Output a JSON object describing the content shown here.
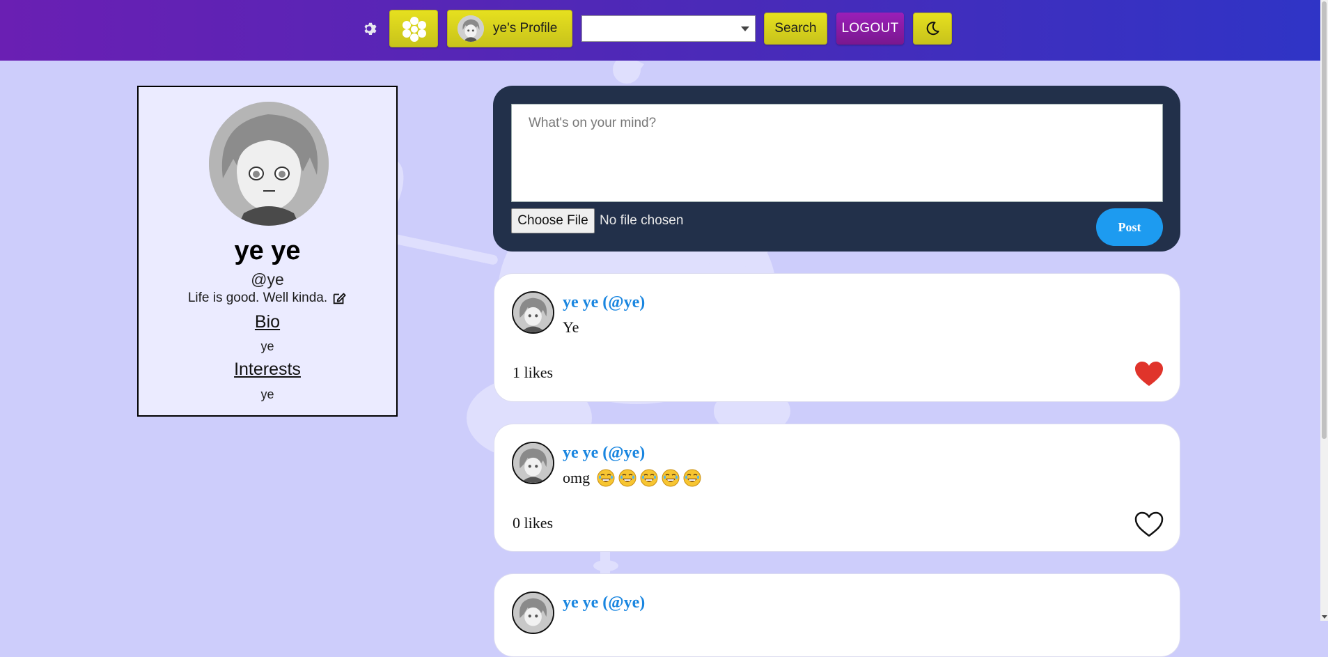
{
  "header": {
    "profile_label": "ye's Profile",
    "search_label": "Search",
    "logout_label": "LOGOUT",
    "select_value": ""
  },
  "profile": {
    "name": "ye ye",
    "handle": "@ye",
    "status": "Life is good. Well kinda.",
    "bio_title": "Bio",
    "bio": "ye",
    "interests_title": "Interests",
    "interests": "ye"
  },
  "composer": {
    "placeholder": "What's on your mind?",
    "file_button": "Choose File",
    "file_status": "No file chosen",
    "post_button": "Post"
  },
  "posts": [
    {
      "author": "ye ye (@ye)",
      "text": "Ye",
      "likes": "1 likes",
      "liked": true
    },
    {
      "author": "ye ye (@ye)",
      "text": "omg",
      "emoji_count": 5,
      "likes": "0 likes",
      "liked": false
    },
    {
      "author": "ye ye (@ye)",
      "text": "",
      "likes": "",
      "liked": false
    }
  ],
  "colors": {
    "header_start": "#6a1fb3",
    "header_end": "#2f34c6",
    "accent_yellow": "#d8d21c",
    "logout_purple": "#8a1aa3",
    "post_blue": "#1d9bf0",
    "author_blue": "#1a86e0",
    "heart_red": "#e0342b",
    "page_bg": "#cdcdfb"
  },
  "icons": {
    "settings": "gear-icon",
    "home": "flower-icon",
    "theme": "moon-icon",
    "edit": "edit-icon",
    "like": "heart-icon"
  }
}
